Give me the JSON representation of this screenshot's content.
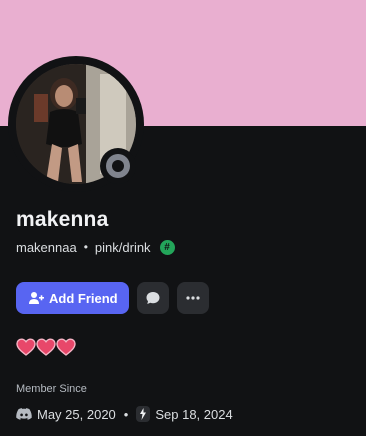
{
  "colors": {
    "banner": "#e9afd0",
    "background": "#111214",
    "accent": "#5865f2",
    "status_offline": "#80848e",
    "badge_green": "#23a55a",
    "heart": "#e8476a"
  },
  "profile": {
    "display_name": "makenna",
    "username": "makennaa",
    "pronouns_status": "pink/drink",
    "status": "offline",
    "badge_icon": "hash-icon"
  },
  "actions": {
    "add_friend_label": "Add Friend",
    "message_icon": "chat-bubble-icon",
    "more_icon": "more-horizontal-icon"
  },
  "bio": {
    "hearts_count": 3
  },
  "member_since": {
    "label": "Member Since",
    "discord_date": "May 25, 2020",
    "server_date": "Sep 18, 2024",
    "discord_icon": "discord-icon",
    "server_icon": "server-icon"
  }
}
